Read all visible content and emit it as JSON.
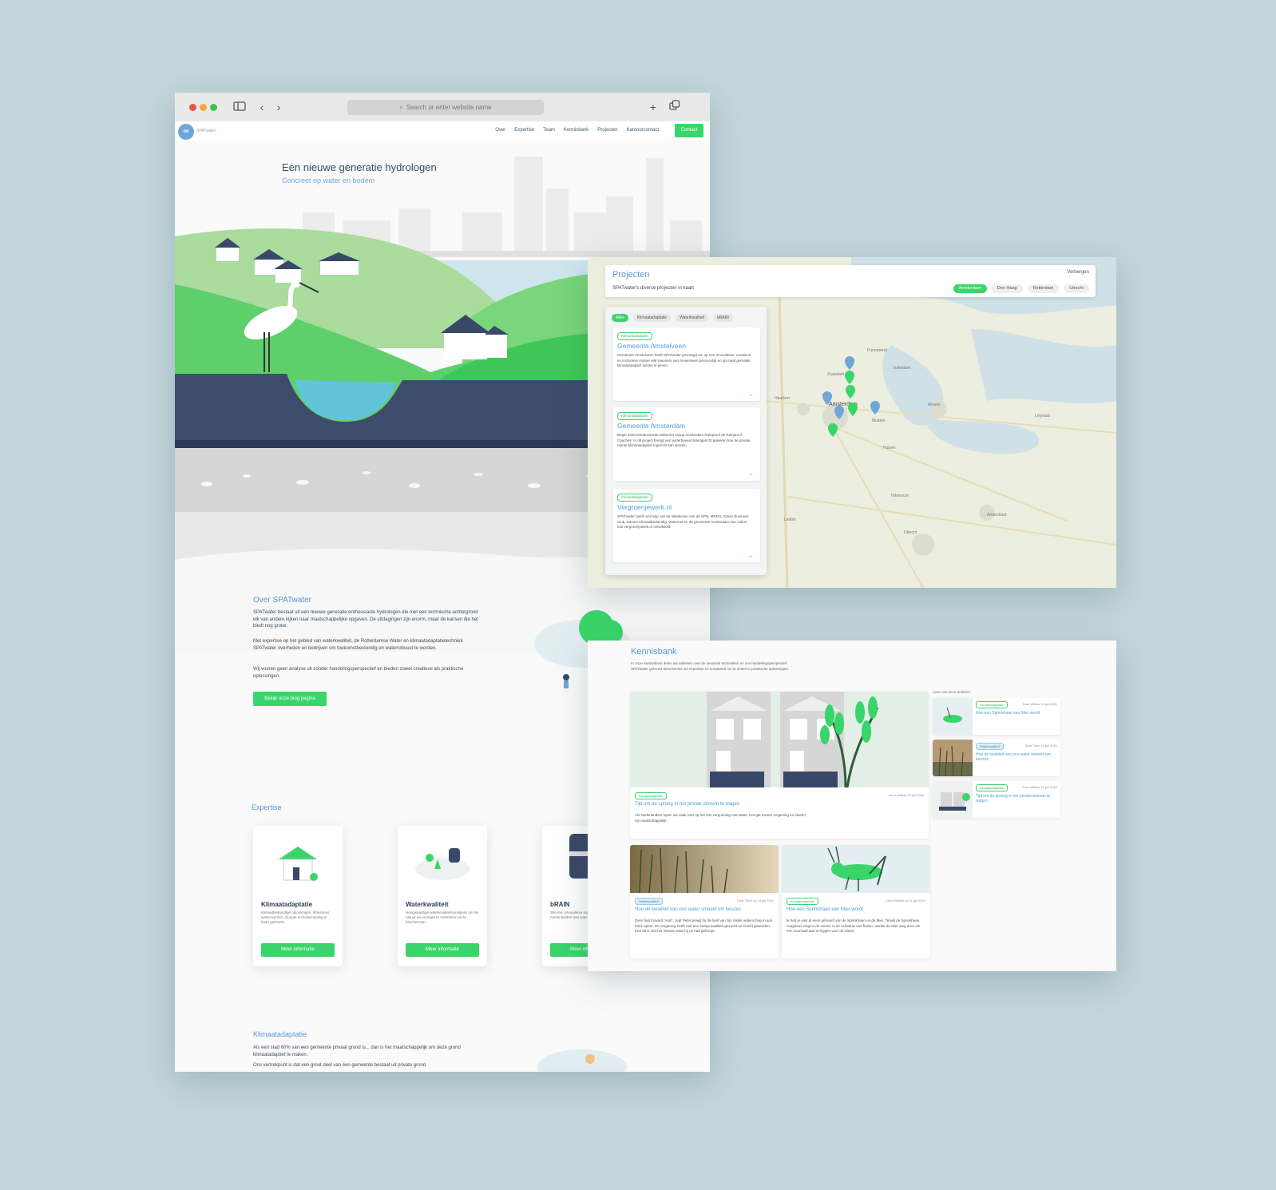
{
  "browser": {
    "address_placeholder": "Search or enter website name",
    "colors": {
      "close": "#ee5247",
      "minimize": "#f5a83a",
      "zoom": "#3dc44d"
    },
    "icons": [
      "sidebar-icon",
      "chevron-left-icon",
      "chevron-right-icon",
      "search-icon",
      "plus-icon",
      "tabs-icon"
    ]
  },
  "site": {
    "logo_text": "SPATwater",
    "nav": {
      "links": [
        "Over",
        "Expertise",
        "Team",
        "Kennisbank",
        "Projecten",
        "Kantoorcontact"
      ],
      "cta": "Contact"
    },
    "hero": {
      "title": "Een nieuwe generatie hydrologen",
      "subtitle": "Concreet op water en bodem"
    },
    "about": {
      "title": "Over SPATwater",
      "p1": "SPATwater bestaat uit een nieuwe generatie enthousiaste hydrologen die met een technische achtergrond elk van andere kijken naar maatschappelijke opgaven. De uitdagingen zijn enorm, maar de kansen die het biedt nog groter.",
      "p2": "Met expertise op het gebied van waterkwaliteit, de Rotterdamse Water en klimaatadaptatietechniek SPATwater overheden en bedrijven om toekomstbestendig en waterrobuust te worden.",
      "p3": "Wij voeren geen analyse uit zonder handelingsperspectief en bieden zowel creatieve als praktische oplossingen.",
      "button": "Bekijk onze blog pagina"
    },
    "expertise": {
      "title": "Expertise",
      "cards": [
        {
          "title": "Klimaatadaptatie",
          "text": "Klimaatbestendige oplossingen, hittestress, wateroverlast, droogte en bodemdaling in kaart gebracht.",
          "button": "Meer informatie",
          "icon": "house-icon"
        },
        {
          "title": "Waterkwaliteit",
          "text": "Hoogwaardige waterkwaliteitsanalyses om de natuur en ecologie te verbeteren en te beschermen.",
          "button": "Meer informatie",
          "icon": "water-sample-icon"
        },
        {
          "title": "bRAIN",
          "text": "Slimme, innovatieve regenwater buffers die ruimte bieden aan water in de stad.",
          "button": "Meer informatie",
          "icon": "rain-barrel-icon"
        }
      ]
    },
    "klimaat": {
      "title": "Klimaatadaptatie",
      "p1": "Als een stad 60% van een gemeente privaat grond is... dan is het maatschappelijk om deze grond klimaatadaptief te maken.",
      "p2": "Ons vertrekpunt is dat een groot deel van een gemeente bestaat uit private grond"
    }
  },
  "projecten": {
    "title": "Projecten",
    "subtitle": "SPATwater's diverse projecten in kaart",
    "hide_label": "Verbergen",
    "cities": [
      "Amsterdam",
      "Den Haag",
      "Rotterdam",
      "Utrecht"
    ],
    "active_city": "Amsterdam",
    "filters": [
      "Alles",
      "Klimaatadaptatie",
      "Waterkwaliteit",
      "bRAIN"
    ],
    "active_filter": "Alles",
    "items": [
      {
        "tag": "Klimaatadaptatie",
        "title": "Gemeente Amstelveen",
        "text": "Gemeente Amstelveen heeft SPATwater gevraagd om op een innovatieve, creatieve en inclusieve manier alle inwoners van Amstelveen persoonlijk en op maat gemaakt klimaatadaptief advies te geven."
      },
      {
        "tag": "Klimaatadaptatie",
        "title": "Gemeente Amsterdam",
        "text": "Begin 2020 introduceerde Waternet vanuit Amsterdam Rainproof de Rainproof Coaches. In dit project brengt een waterbewust klantgericht gekeken hoe de private ruimte klimaatadaptief ingericht kan worden."
      },
      {
        "tag": "Klimaatadaptatie",
        "title": "Vergroenjewerk.nl",
        "text": "SPATwater heeft met hulp van de initiatieven van de SPN, MRDH, Green Business Club, Samen Klimaatbestendig, Waternet en de gemeente Amsterdam een online tool vergroenjewerk.nl ontwikkeld."
      }
    ],
    "map_labels": [
      "Zaandam",
      "Purmerend",
      "Volendam",
      "Haarlem",
      "Amsterdam",
      "Almere",
      "Hilversum",
      "Utrecht",
      "Amersfoort",
      "Leiden",
      "Lelystad",
      "Huizen",
      "Muiden"
    ],
    "marker_color": "#6ea6d6",
    "marker_green": "#3ad56a"
  },
  "kennisbank": {
    "title": "Kennisbank",
    "intro": "In onze Kennisbank delen we artikelen over de nieuwste technieken en ons handelingsperspectief. SPATwater gebruikt deze kennis om expertise en creativiteit om te zetten in praktische oplossingen.",
    "featured": {
      "tag": "Klimaatadaptatie",
      "date": "Door Wietse 10 juli 2022",
      "title": "Tijd om de sprong in het private domein te wagen",
      "text": "Als Nederlanders lopen we vaak vast op het niet vergunning met water. Het gat tussen omgeving en ideeën. Op maatschappelijk."
    },
    "side_label": "Lees ook deze artikelen",
    "side": [
      {
        "tag": "Klimaatadaptatie",
        "date": "Door Wietse 11 juli 2021",
        "title": "Hoe een Sprinkhaan een Mier wordt"
      },
      {
        "tag": "Waterkwaliteit",
        "date": "Door Theo 14 juli 2021",
        "title": "Hoe de kwaliteit van ons water smeekt om keuzes"
      },
      {
        "tag": "Klimaatadaptatie",
        "date": "Door Wietse 10 juli 2022",
        "title": "Tijd om de sprong in het private domein te wagen"
      }
    ],
    "bottom": [
      {
        "tag": "Waterkwaliteit",
        "date": "Door Theo op 14 juli 2021",
        "title": "Hoe de kwaliteit van ons water smeekt om keuzes",
        "text": "Even fast forward. 'Huh', zegt Peter terwijl hij de brief van zijn lokale waterschap in juni 2021 opent. De omgeving heeft met een beetje kwaliteit gezocht en kracht geworden. Een dit is niet het nieuwe waar hij op had gehoopt."
      },
      {
        "tag": "Klimaatadaptatie",
        "date": "Door Wietse op 11 juli 2021",
        "title": "Hoe een Sprinkhaan een Mier wordt",
        "text": "Ik heb je vast al eens gehoord van de Sprinkhaan en de Mier. Terwijl de Sprinkhaan zorgeloos zingt in de zomer, in de schaduw van fluiten, werkte de Mier stug door om een voorraad aan te leggen voor de winter."
      }
    ]
  }
}
